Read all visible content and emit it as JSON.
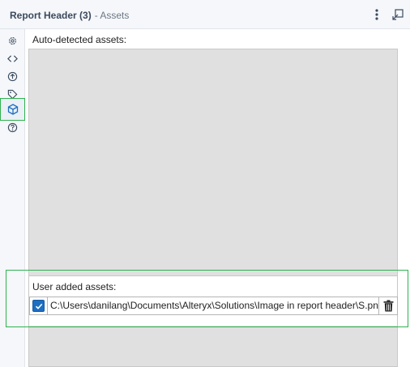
{
  "header": {
    "title": "Report Header (3)",
    "subtitle": "- Assets",
    "more_icon": "more-vertical-icon",
    "undock_icon": "undock-window-icon"
  },
  "sidebar": {
    "items": [
      {
        "icon": "gear-icon",
        "active": false
      },
      {
        "icon": "code-icon",
        "active": false
      },
      {
        "icon": "connection-icon",
        "active": false
      },
      {
        "icon": "tag-icon",
        "active": false
      },
      {
        "icon": "cube-icon",
        "active": true
      },
      {
        "icon": "help-icon",
        "active": false
      }
    ]
  },
  "main": {
    "auto_detected_label": "Auto-detected assets:",
    "user_added_label": "User added assets:",
    "user_assets": [
      {
        "checked": true,
        "path": "C:\\Users\\danilang\\Documents\\Alteryx\\Solutions\\Image in report header\\S.png",
        "delete_icon": "trash-icon"
      }
    ]
  },
  "colors": {
    "highlight": "#2fb24f",
    "checkbox": "#1c6ec2",
    "panel_background": "#e0e0e0",
    "header_text": "#3b4a5e"
  }
}
